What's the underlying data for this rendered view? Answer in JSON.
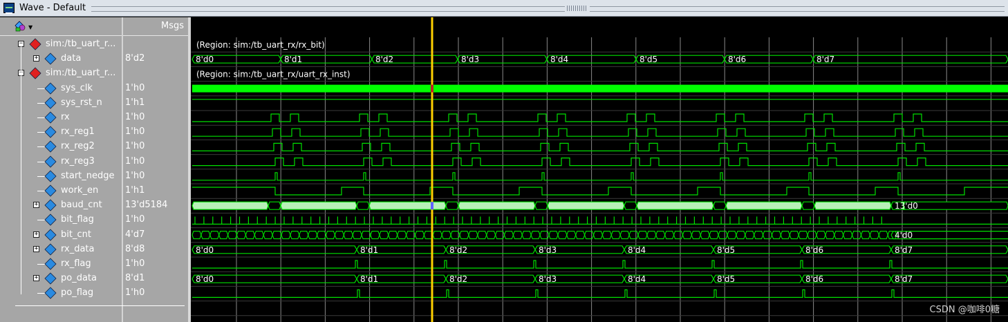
{
  "window": {
    "title": "Wave - Default"
  },
  "header": {
    "msgs_label": "Msgs"
  },
  "region_labels": [
    "(Region: sim:/tb_uart_rx/rx_bit)",
    "(Region: sim:/tb_uart_rx/uart_rx_inst)"
  ],
  "signals": [
    {
      "name": "sim:/tb_uart_r...",
      "value": "",
      "kind": "region"
    },
    {
      "name": "data",
      "value": "8'd2",
      "kind": "bus"
    },
    {
      "name": "sim:/tb_uart_r...",
      "value": "",
      "kind": "region"
    },
    {
      "name": "sys_clk",
      "value": "1'h0",
      "kind": "clock"
    },
    {
      "name": "sys_rst_n",
      "value": "1'h1",
      "kind": "bit"
    },
    {
      "name": "rx",
      "value": "1'h0",
      "kind": "bit"
    },
    {
      "name": "rx_reg1",
      "value": "1'h0",
      "kind": "bit"
    },
    {
      "name": "rx_reg2",
      "value": "1'h0",
      "kind": "bit"
    },
    {
      "name": "rx_reg3",
      "value": "1'h0",
      "kind": "bit"
    },
    {
      "name": "start_nedge",
      "value": "1'h0",
      "kind": "bit"
    },
    {
      "name": "work_en",
      "value": "1'h1",
      "kind": "bit"
    },
    {
      "name": "baud_cnt",
      "value": "13'd5184",
      "kind": "bus"
    },
    {
      "name": "bit_flag",
      "value": "1'h0",
      "kind": "bit"
    },
    {
      "name": "bit_cnt",
      "value": "4'd7",
      "kind": "bus"
    },
    {
      "name": "rx_data",
      "value": "8'd8",
      "kind": "bus"
    },
    {
      "name": "rx_flag",
      "value": "1'h0",
      "kind": "bit"
    },
    {
      "name": "po_data",
      "value": "8'd1",
      "kind": "bus"
    },
    {
      "name": "po_flag",
      "value": "1'h0",
      "kind": "bit"
    }
  ],
  "wave_labels": {
    "data": [
      "8'd0",
      "8'd1",
      "8'd2",
      "8'd3",
      "8'd4",
      "8'd5",
      "8'd6",
      "8'd7"
    ],
    "baud_cnt_end": "13'd0",
    "bit_cnt_end": "4'd0",
    "rx_data": [
      "8'd0",
      "8'd1",
      "8'd2",
      "8'd3",
      "8'd4",
      "8'd5",
      "8'd6",
      "8'd7"
    ],
    "po_data": [
      "8'd0",
      "8'd1",
      "8'd2",
      "8'd3",
      "8'd4",
      "8'd5",
      "8'd6",
      "8'd7"
    ]
  },
  "icons": {
    "window_icon": "waveform-window-icon",
    "toolbar_icon": "shapes-dropdown-icon",
    "region_icon": "red-diamond-icon",
    "signal_icon": "blue-diamond-icon"
  },
  "colors": {
    "wave": "#00e000",
    "bus_fill": "#b8f0b8",
    "clock_fill": "#00ff00",
    "cursor": "#ffd000",
    "grid": "#8a8a8a",
    "panel": "#a6a6a6",
    "background": "#000000"
  },
  "watermark": "CSDN @咖啡0糖"
}
